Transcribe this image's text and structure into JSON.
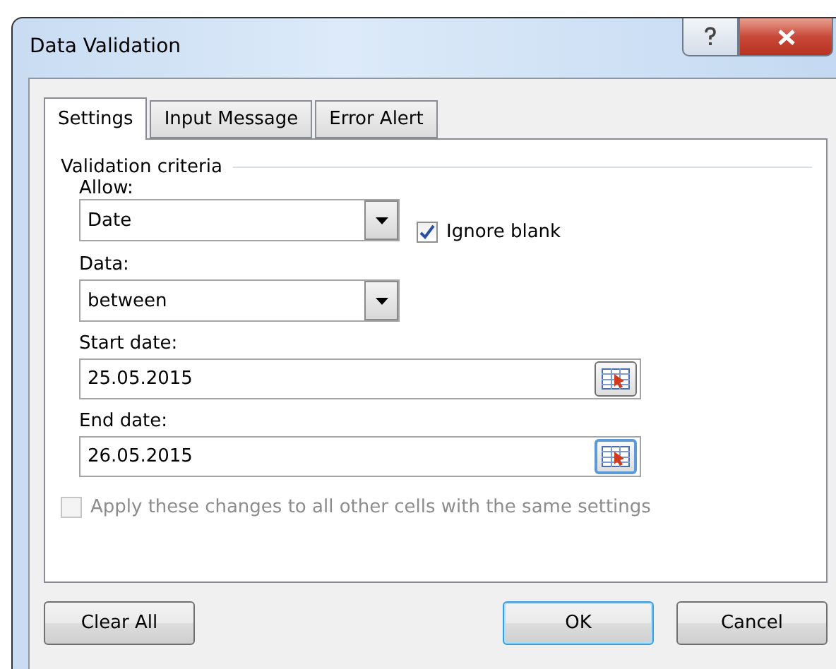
{
  "window": {
    "title": "Data Validation"
  },
  "tabs": [
    {
      "label": "Settings",
      "selected": true
    },
    {
      "label": "Input Message",
      "selected": false
    },
    {
      "label": "Error Alert",
      "selected": false
    }
  ],
  "criteria": {
    "heading": "Validation criteria",
    "allow": {
      "label": "Allow:",
      "value": "Date"
    },
    "ignore_blank": {
      "label": "Ignore blank",
      "checked": true
    },
    "data": {
      "label": "Data:",
      "value": "between"
    },
    "start_date": {
      "label": "Start date:",
      "value": "25.05.2015",
      "focused": false
    },
    "end_date": {
      "label": "End date:",
      "value": "26.05.2015",
      "focused": true
    }
  },
  "apply_all": {
    "label": "Apply these changes to all other cells with the same settings",
    "checked": false,
    "disabled": true
  },
  "buttons": [
    {
      "label": "Clear All",
      "default": false
    },
    {
      "label": "OK",
      "default": true
    },
    {
      "label": "Cancel",
      "default": false
    }
  ]
}
